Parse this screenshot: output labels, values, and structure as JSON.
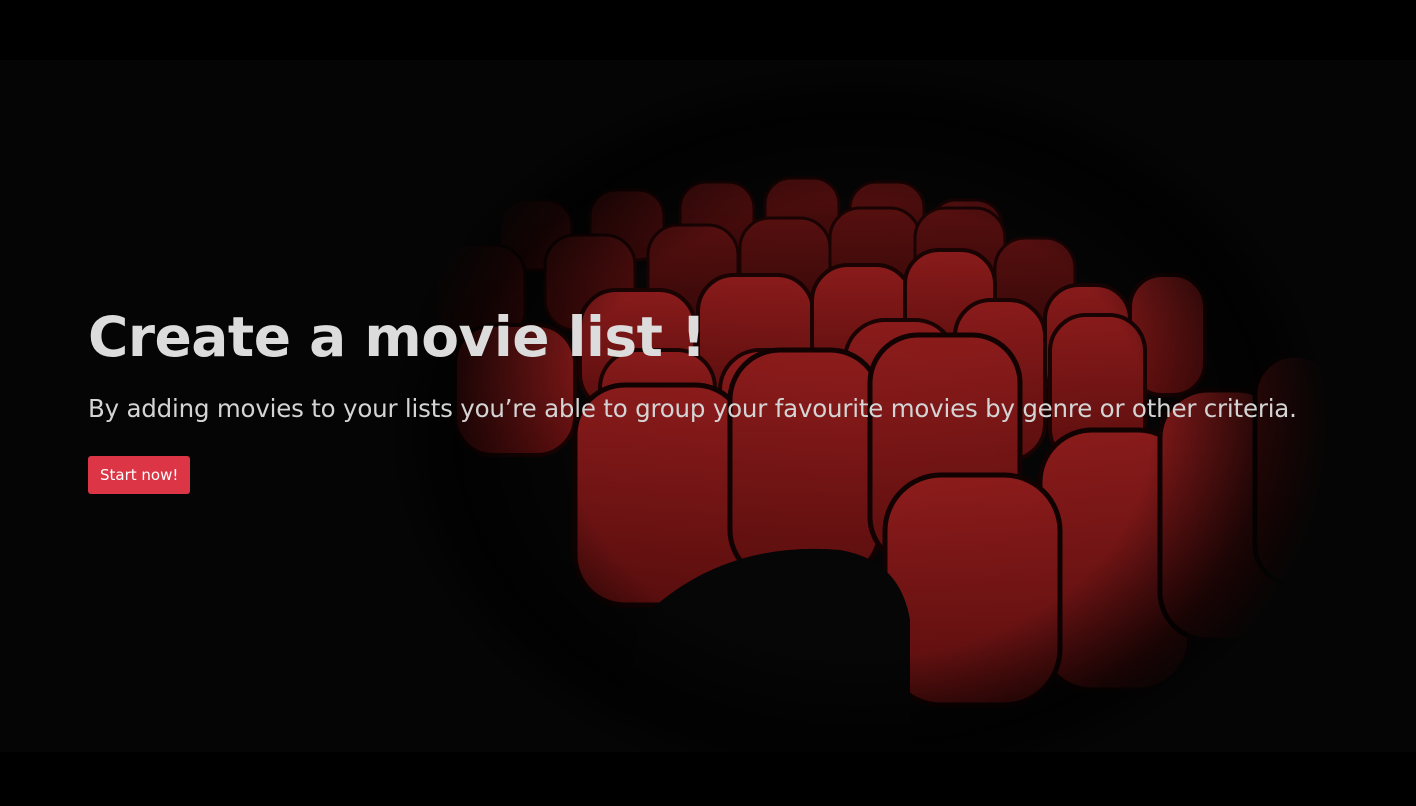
{
  "hero": {
    "title": "Create a movie list !",
    "subtitle": "By adding movies to your lists you’re able to group your favourite movies by genre or other criteria.",
    "cta_label": "Start now!",
    "background_image": "cinema-seats-image"
  },
  "colors": {
    "background": "#000000",
    "title_text": "#dcdcdc",
    "subtitle_text": "#d4d4d4",
    "button_bg": "#dc3545",
    "button_text": "#ffffff",
    "seat_red": "#8a1a1a"
  }
}
